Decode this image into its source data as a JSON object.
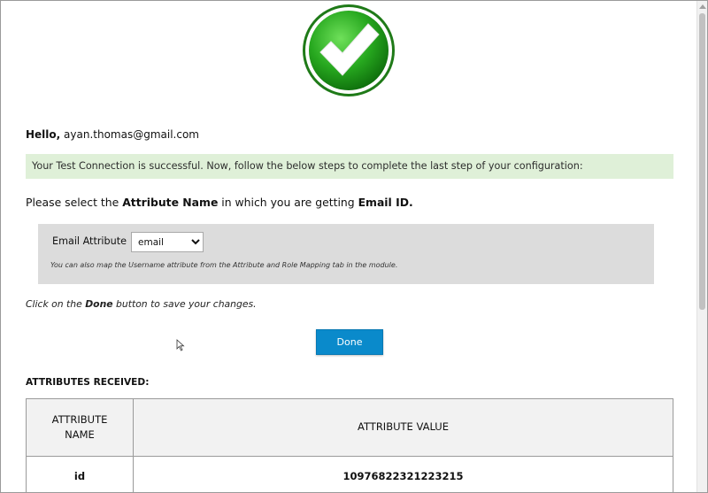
{
  "greeting": {
    "prefix": "Hello,",
    "email": "ayan.thomas@gmail.com"
  },
  "banner": {
    "text": "Your Test Connection is successful. Now, follow the below steps to complete the last step of your configuration:",
    "background": "#dff0d8"
  },
  "instruction": {
    "part1": "Please select the ",
    "bold1": "Attribute Name",
    "part2": " in which you are getting ",
    "bold2": "Email ID."
  },
  "email_attribute": {
    "label": "Email Attribute",
    "selected": "email",
    "hint": "You can also map the Username attribute from the Attribute and Role Mapping tab in the module."
  },
  "done_note": {
    "part1": "Click on the ",
    "bold": "Done",
    "part2": " button to save your changes."
  },
  "done_button": {
    "label": "Done",
    "color": "#0a8acb"
  },
  "attributes": {
    "heading": "ATTRIBUTES RECEIVED:",
    "header_name": "ATTRIBUTE NAME",
    "header_value": "ATTRIBUTE VALUE",
    "rows": [
      {
        "name": "id",
        "value": "10976822321223215"
      }
    ]
  },
  "icons": {
    "status": "success-checkmark-icon",
    "select": "chevron-down-icon",
    "pointer": "mouse-cursor-icon"
  },
  "colors": {
    "success_green": "#2ea12b",
    "table_border": "#9a9a9a"
  }
}
